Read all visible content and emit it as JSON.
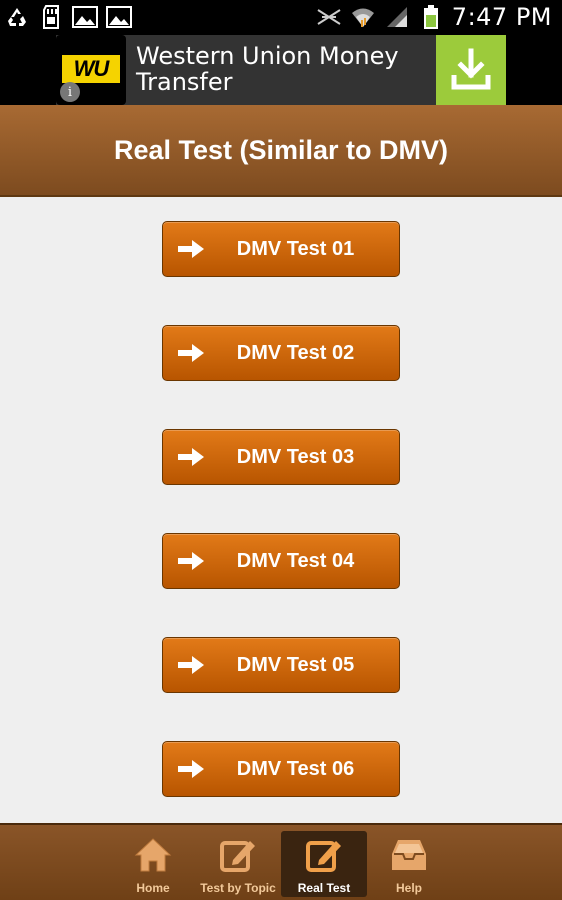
{
  "status_bar": {
    "time": "7:47 PM",
    "left_icons": [
      "recycle-icon",
      "sd-card-icon",
      "image-icon",
      "image-icon"
    ],
    "right_icons": [
      "signal-blocked-icon",
      "wifi-icon",
      "cell-signal-icon",
      "battery-icon"
    ]
  },
  "ad": {
    "logo_text": "WU",
    "title": "Western Union Money Transfer",
    "info_glyph": "i",
    "brand_color": "#f5d300",
    "download_color": "#9ccb3b"
  },
  "header": {
    "title": "Real Test (Similar to DMV)"
  },
  "tests": [
    {
      "label": "DMV Test 01"
    },
    {
      "label": "DMV Test 02"
    },
    {
      "label": "DMV Test 03"
    },
    {
      "label": "DMV Test 04"
    },
    {
      "label": "DMV Test 05"
    },
    {
      "label": "DMV Test 06"
    }
  ],
  "nav": {
    "items": [
      {
        "label": "Home",
        "icon": "home-icon",
        "active": false
      },
      {
        "label": "Test by Topic",
        "icon": "edit-icon",
        "active": false
      },
      {
        "label": "Real Test",
        "icon": "edit-icon",
        "active": true
      },
      {
        "label": "Help",
        "icon": "inbox-icon",
        "active": false
      }
    ]
  },
  "colors": {
    "button_accent": "#d06a10",
    "header_brown": "#9a6130",
    "background": "#efefef"
  }
}
